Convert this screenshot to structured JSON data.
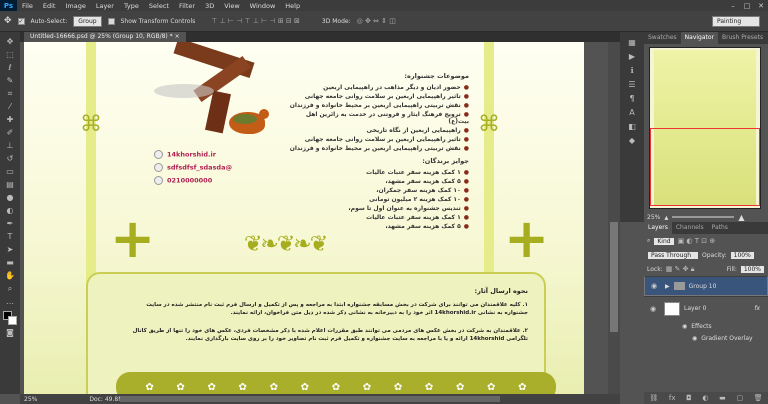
{
  "app": {
    "logo": "Ps",
    "menu": [
      "File",
      "Edit",
      "Image",
      "Layer",
      "Type",
      "Select",
      "Filter",
      "3D",
      "View",
      "Window",
      "Help"
    ]
  },
  "options": {
    "auto_select_label": "Auto-Select:",
    "auto_select_value": "Group",
    "show_transform_label": "Show Transform Controls",
    "mode_label": "3D Mode:",
    "workspace": "Painting"
  },
  "document": {
    "tab_title": "Untitled-16666.psd @ 25% (Group 10, RGB/8) *",
    "heading1": "موضوعات جشنواره:",
    "topics": [
      "حضور ادیان و دیگر مذاهب در راهپیمایی اربعین",
      "تاثیر راهپیمایی اربعین بر سلامت روانی جامعه جهانی",
      "نقش تربیتی راهپیمایی اربعین بر محیط خانواده و فرزندان",
      "ترویج فرهنگ ایثار و فروتنی در خدمت به زائرین اهل بیت(ع)",
      "راهپیمایی اربعین از نگاه تاریخی",
      "تاثیر راهپیمایی اربعین بر سلامت روانی جامعه جهانی",
      "نقش تربیتی راهپیمایی اربعین بر محیط خانواده و فرزندان"
    ],
    "heading2": "جوایز برندگان:",
    "prizes": [
      "۱ کمک هزینه سفر عتبات عالیات",
      "۵ کمک هزینه سفر مشهد،",
      "۱۰ کمک هزینه سفر جمکران،",
      "۱۰ کمک هزینه ۲ میلیون تومانی",
      "تندیس جشنواره به عنوان اول تا سوم،",
      "۱ کمک هزینه سفر عتبات عالیات",
      "۵ کمک هزینه سفر مشهد،"
    ],
    "contact": {
      "website": "14khorshid.ir",
      "social": "sdfsdfsf_sdasda@",
      "phone": "0210000000"
    },
    "howto_title": "نحوه ارسال آثار:",
    "howto_p1": "۱. کلیه علاقمندان می توانند برای شرکت در بخش مسابقه جشنواره ابتدا به مراجعه و پس از تکمیل و ارسال فرم ثبت نام منتشر شده در سایت جشنواره به نشانی 14khorshid.ir اثر خود را به دبیرخانه به نشانی ذکر شده در ذیل متن فراخوان، ارائه نمایند.",
    "howto_p2": "۲. علاقمندان به شرکت در بخش عکس های مردمی می توانند طبق مقررات اعلام شده با ذکر مشخصات فردی، عکس های خود را تنها از طریق کانال تلگرامی 14khorshid ارائه و یا با مراجعه به سایت جشنواره و تکمیل فرم ثبت نام تصاویر خود را بر روی سایت بارگذاری نمایند."
  },
  "footer_logo_count": 13,
  "status": {
    "zoom": "25%",
    "doc": "Doc: 49.8M/127.3M"
  },
  "panels": {
    "tabs": [
      "Swatches",
      "Navigator",
      "Brush Presets"
    ],
    "nav_zoom": "25%",
    "layer_tabs": [
      "Layers",
      "Channels",
      "Paths"
    ],
    "filter": "Kind",
    "blend": "Pass Through",
    "opacity_label": "Opacity:",
    "opacity": "100%",
    "lock_label": "Lock:",
    "fill_label": "Fill:",
    "fill": "100%",
    "layers": [
      {
        "name": "Group 10"
      },
      {
        "name": "Layer 0",
        "fx": "fx"
      }
    ],
    "effects_label": "Effects",
    "effect": "Gradient Overlay"
  }
}
